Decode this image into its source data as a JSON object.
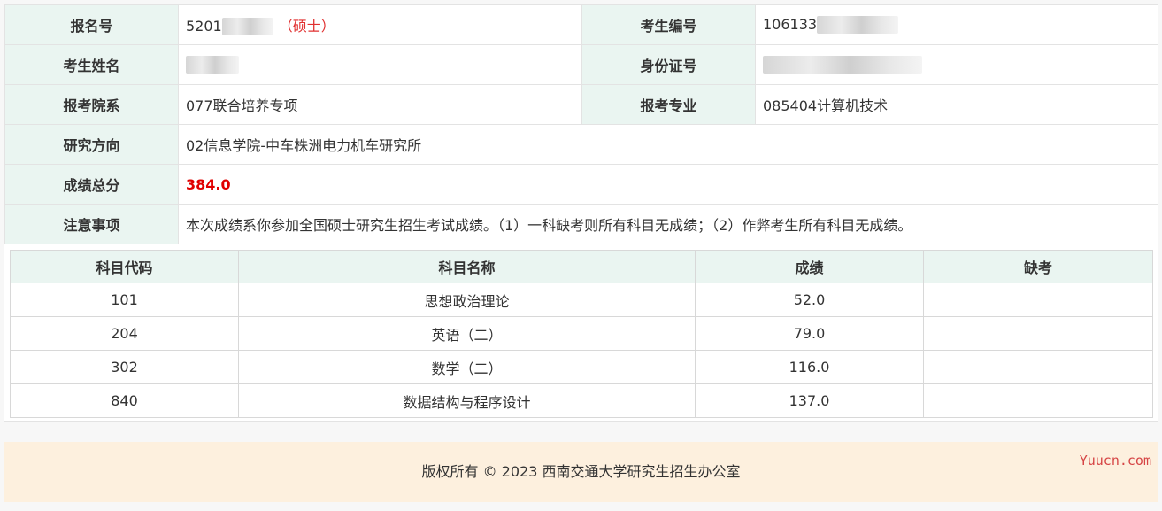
{
  "info": {
    "reg_no_label": "报名号",
    "reg_no_value": "5201",
    "degree_tag": "（硕士）",
    "exam_no_label": "考生编号",
    "exam_no_value": "106133",
    "name_label": "考生姓名",
    "id_label": "身份证号",
    "dept_label": "报考院系",
    "dept_value": "077联合培养专项",
    "major_label": "报考专业",
    "major_value": "085404计算机技术",
    "direction_label": "研究方向",
    "direction_value": "02信息学院-中车株洲电力机车研究所",
    "total_label": "成绩总分",
    "total_value": "384.0",
    "notes_label": "注意事项",
    "notes_value": "本次成绩系你参加全国硕士研究生招生考试成绩。（1）一科缺考则所有科目无成绩；（2）作弊考生所有科目无成绩。"
  },
  "subjects": {
    "headers": [
      "科目代码",
      "科目名称",
      "成绩",
      "缺考"
    ],
    "rows": [
      {
        "code": "101",
        "name": "思想政治理论",
        "score": "52.0",
        "absent": ""
      },
      {
        "code": "204",
        "name": "英语（二）",
        "score": "79.0",
        "absent": ""
      },
      {
        "code": "302",
        "name": "数学（二）",
        "score": "116.0",
        "absent": ""
      },
      {
        "code": "840",
        "name": "数据结构与程序设计",
        "score": "137.0",
        "absent": ""
      }
    ]
  },
  "footer": {
    "copyright": "版权所有 © 2023 西南交通大学研究生招生办公室"
  },
  "watermark": "Yuucn.com"
}
